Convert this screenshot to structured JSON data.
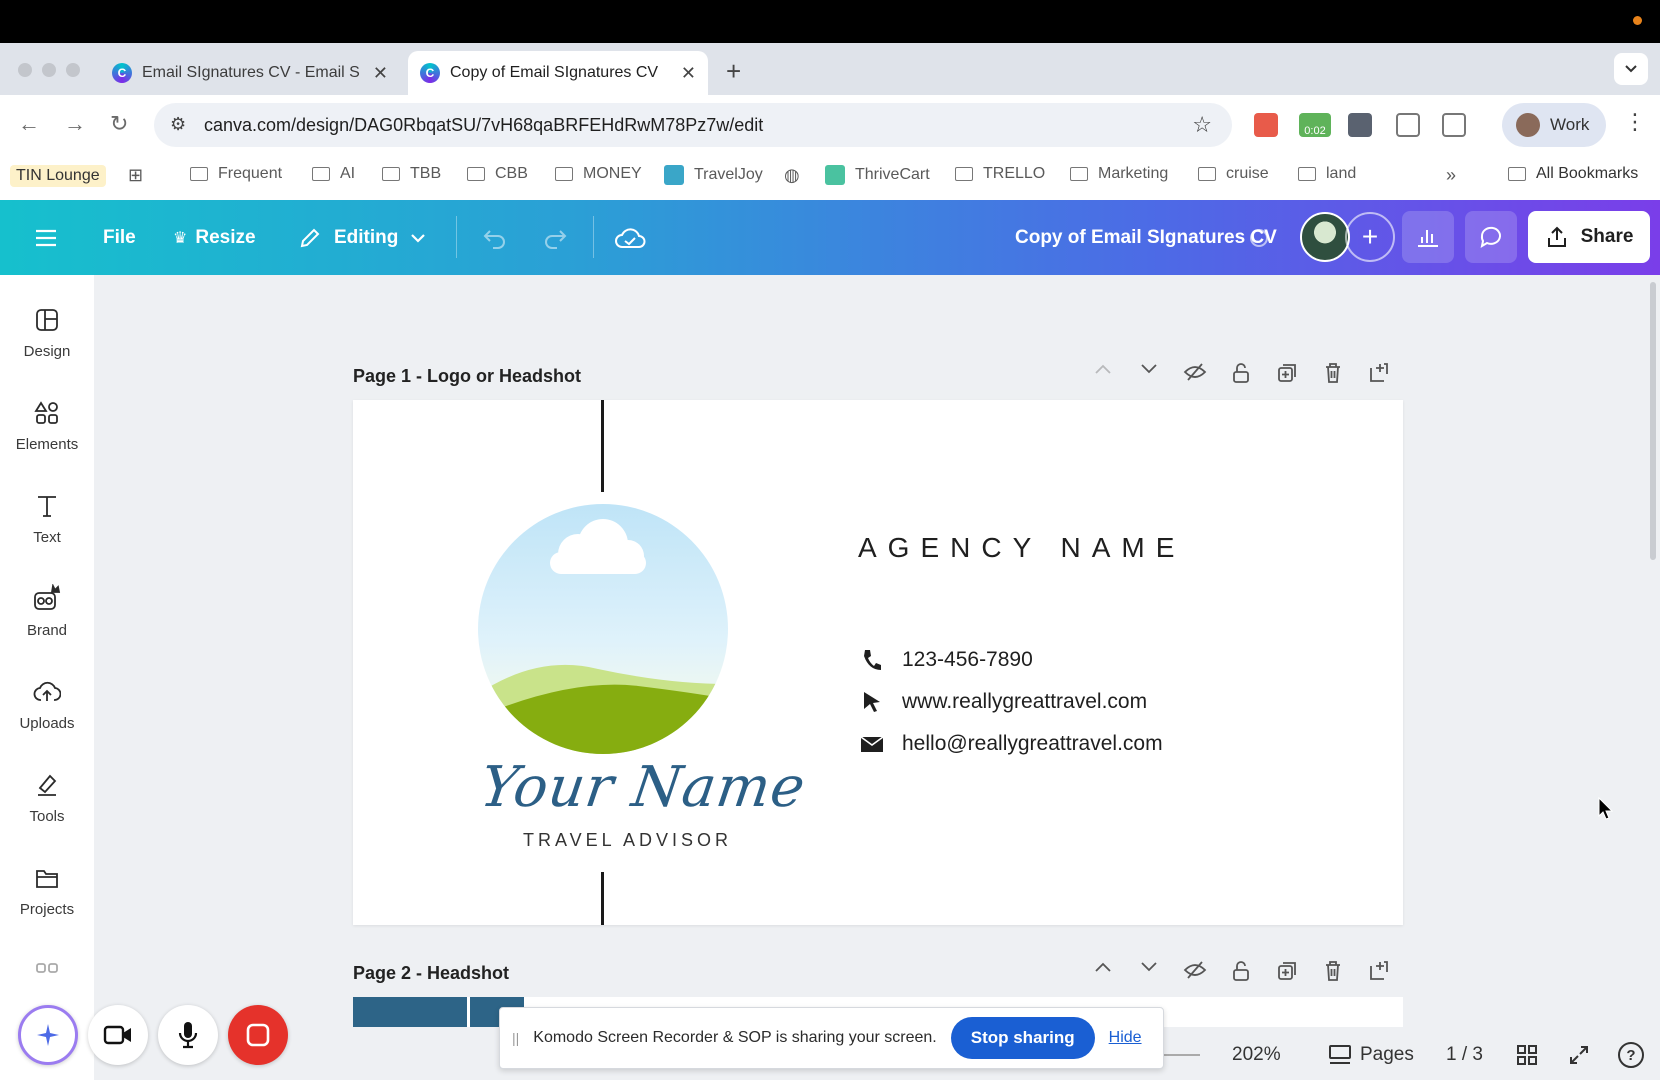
{
  "browser": {
    "tabs": [
      {
        "title": "Email SIgnatures CV - Email S",
        "active": false
      },
      {
        "title": "Copy of Email SIgnatures CV",
        "active": true
      }
    ],
    "new_tab": "+",
    "url": "canva.com/design/DAG0RbqatSU/7vH68qaBRFEHdRwM78Pz7w/edit",
    "ext_timer": "0:02",
    "profile": "Work",
    "bookmarks": [
      "TIN Lounge",
      "Frequent",
      "AI",
      "TBB",
      "CBB",
      "MONEY",
      "TravelJoy",
      "ThriveCart",
      "TRELLO",
      "Marketing",
      "cruise",
      "land"
    ],
    "all_bookmarks": "All Bookmarks",
    "overflow": "»"
  },
  "canva": {
    "file": "File",
    "resize": "Resize",
    "editing": "Editing",
    "doc_title": "Copy of Email SIgnatures CV",
    "share": "Share",
    "sidebar": [
      "Design",
      "Elements",
      "Text",
      "Brand",
      "Uploads",
      "Tools",
      "Projects"
    ],
    "page1_label": "Page 1 - Logo or Headshot",
    "page2_label": "Page 2 - Headshot",
    "design": {
      "signature": "Your Name",
      "role": "TRAVEL ADVISOR",
      "agency": "AGENCY NAME",
      "phone": "123-456-7890",
      "website": "www.reallygreattravel.com",
      "email": "hello@reallygreattravel.com"
    },
    "zoom": "202%",
    "pages_label": "Pages",
    "page_count": "1 / 3",
    "help": "?"
  },
  "screen_share": {
    "message": "Komodo Screen Recorder & SOP is sharing your screen.",
    "stop": "Stop sharing",
    "hide": "Hide"
  },
  "colors": {
    "accent_blue": "#1a5fd3",
    "signature_blue": "#2c5f86",
    "header_gradient_start": "#16c0cd",
    "header_gradient_end": "#7a3ee9"
  }
}
